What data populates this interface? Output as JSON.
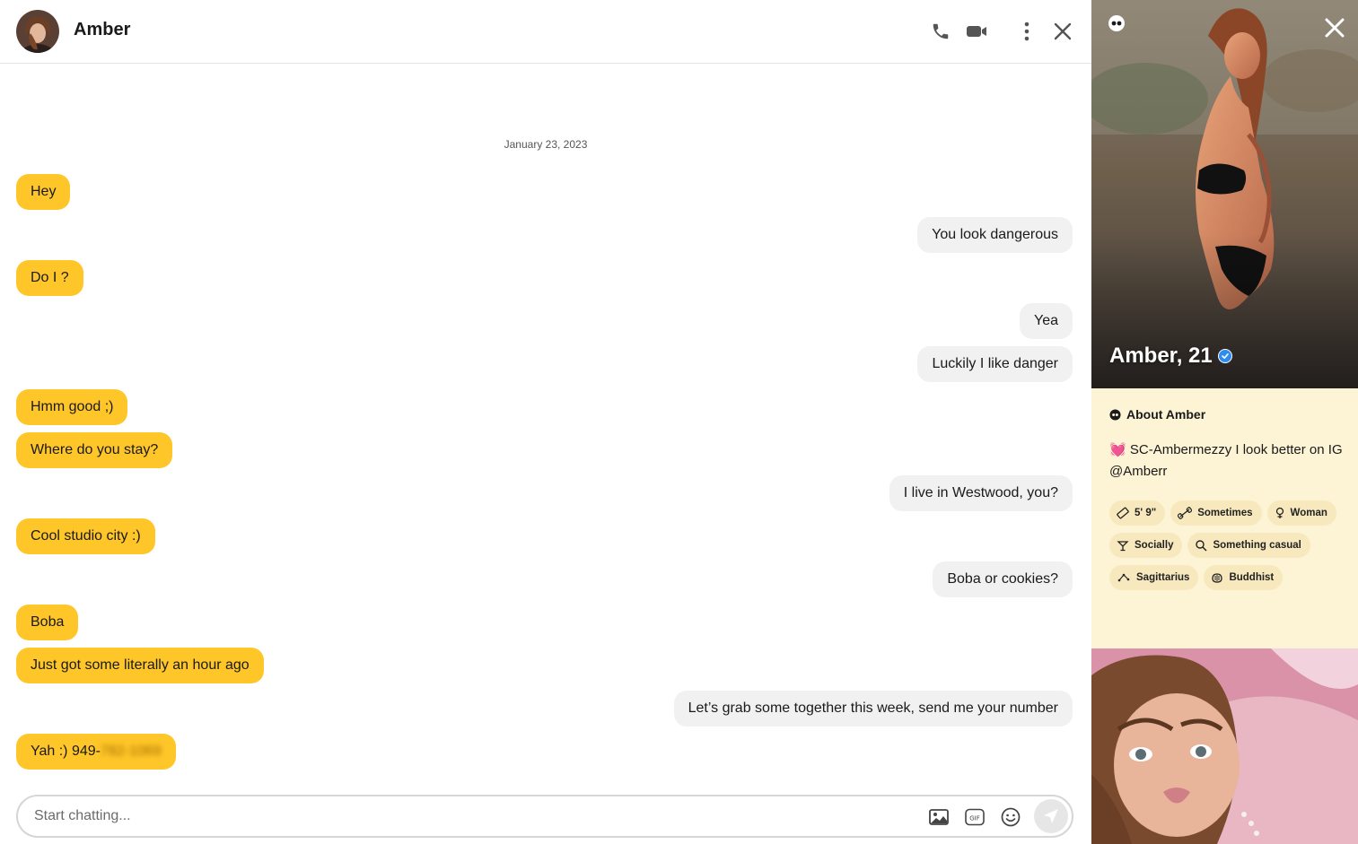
{
  "header": {
    "name": "Amber",
    "call_icon": "phone-icon",
    "video_icon": "video-camera-icon",
    "more_icon": "more-vertical-icon",
    "close_icon": "close-icon"
  },
  "conversation": {
    "date": "January 23, 2023",
    "messages": [
      {
        "from": "them",
        "text": "Hey"
      },
      {
        "from": "me",
        "text": "You look dangerous"
      },
      {
        "from": "them",
        "text": "Do I ?"
      },
      {
        "from": "me",
        "text": "Yea"
      },
      {
        "from": "me",
        "text": "Luckily I like danger"
      },
      {
        "from": "them",
        "text": "Hmm good ;)"
      },
      {
        "from": "them",
        "text": "Where do you stay?"
      },
      {
        "from": "me",
        "text": "I live in Westwood, you?"
      },
      {
        "from": "them",
        "text": "Cool studio city :)"
      },
      {
        "from": "me",
        "text": "Boba or cookies?"
      },
      {
        "from": "them",
        "text": "Boba"
      },
      {
        "from": "them",
        "text": "Just got some literally an hour ago"
      },
      {
        "from": "me",
        "text": "Let’s grab some together this week, send me your number"
      },
      {
        "from": "them",
        "text": "Yah :) 949-",
        "blurred_suffix": "782-1069"
      }
    ]
  },
  "composer": {
    "placeholder": "Start chatting...",
    "icons": [
      "image-icon",
      "gif-icon",
      "emoji-icon",
      "send-icon"
    ]
  },
  "profile": {
    "name_age": "Amber, 21",
    "verified": true,
    "about_title": "About Amber",
    "bio_emoji": "💓",
    "bio": "SC-Ambermezzy I look better on IG @Amberr",
    "chips": [
      {
        "icon": "ruler-icon",
        "label": "5' 9\""
      },
      {
        "icon": "dumbbell-icon",
        "label": "Sometimes"
      },
      {
        "icon": "gender-icon",
        "label": "Woman"
      },
      {
        "icon": "drink-icon",
        "label": "Socially"
      },
      {
        "icon": "search-icon",
        "label": "Something casual"
      },
      {
        "icon": "zodiac-icon",
        "label": "Sagittarius"
      },
      {
        "icon": "religion-icon",
        "label": "Buddhist"
      }
    ]
  },
  "colors": {
    "accent": "#ffc629",
    "panel_bg": "#fdf3d5",
    "chip_bg": "#f7e9bd",
    "outgoing_bg": "#f1f1f1",
    "verified": "#2d8cf0"
  }
}
